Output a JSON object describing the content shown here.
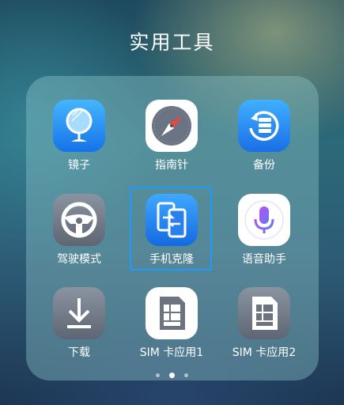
{
  "folder": {
    "title": "实用工具",
    "page_count": 3,
    "current_page": 2
  },
  "apps": [
    {
      "label": "镜子",
      "icon": "mirror-icon",
      "color": "#1e88f5"
    },
    {
      "label": "指南针",
      "icon": "compass-icon",
      "color": "#ffffff"
    },
    {
      "label": "备份",
      "icon": "backup-icon",
      "color": "#2a8cf0"
    },
    {
      "label": "驾驶模式",
      "icon": "steering-wheel-icon",
      "color": "#707986"
    },
    {
      "label": "手机克隆",
      "icon": "phone-clone-icon",
      "color": "#1e8ef5",
      "selected": true
    },
    {
      "label": "语音助手",
      "icon": "voice-assistant-icon",
      "color": "#ffffff"
    },
    {
      "label": "下载",
      "icon": "download-icon",
      "color": "#707986"
    },
    {
      "label": "SIM 卡应用1",
      "icon": "sim-card-1-icon",
      "color": "#ffffff"
    },
    {
      "label": "SIM 卡应用2",
      "icon": "sim-card-2-icon",
      "color": "#707986"
    }
  ],
  "colors": {
    "selection_border": "#1e9bff",
    "panel": "rgba(140,195,200,0.42)"
  }
}
